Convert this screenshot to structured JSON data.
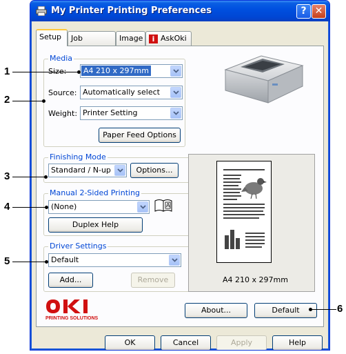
{
  "window": {
    "title": "My Printer Printing Preferences",
    "help_glyph": "?",
    "close_glyph": "✕"
  },
  "tabs": [
    {
      "label": "Setup",
      "active": true
    },
    {
      "label": "Job Options"
    },
    {
      "label": "Image"
    },
    {
      "label": "AskOki",
      "icon_char": "i"
    }
  ],
  "media": {
    "title": "Media",
    "size_label": "Size:",
    "size_value": "A4 210 x 297mm",
    "source_label": "Source:",
    "source_value": "Automatically select",
    "weight_label": "Weight:",
    "weight_value": "Printer Setting",
    "paper_feed_button": "Paper Feed Options"
  },
  "finishing": {
    "title": "Finishing Mode",
    "value": "Standard / N-up",
    "options_button": "Options..."
  },
  "two_sided": {
    "title": "Manual 2-Sided Printing",
    "value": "(None)",
    "duplex_help_button": "Duplex Help",
    "book_icon_letter": "A"
  },
  "driver": {
    "title": "Driver Settings",
    "value": "Default",
    "add_button": "Add...",
    "remove_button": "Remove"
  },
  "preview": {
    "paper_size": "A4 210 x 297mm"
  },
  "brand": {
    "logo": "OKI",
    "tagline": "PRINTING SOLUTIONS",
    "color": "#d01010"
  },
  "buttons": {
    "about": "About...",
    "default": "Default",
    "ok": "OK",
    "cancel": "Cancel",
    "apply": "Apply",
    "help": "Help"
  },
  "callouts": [
    "1",
    "2",
    "3",
    "4",
    "5",
    "6"
  ]
}
